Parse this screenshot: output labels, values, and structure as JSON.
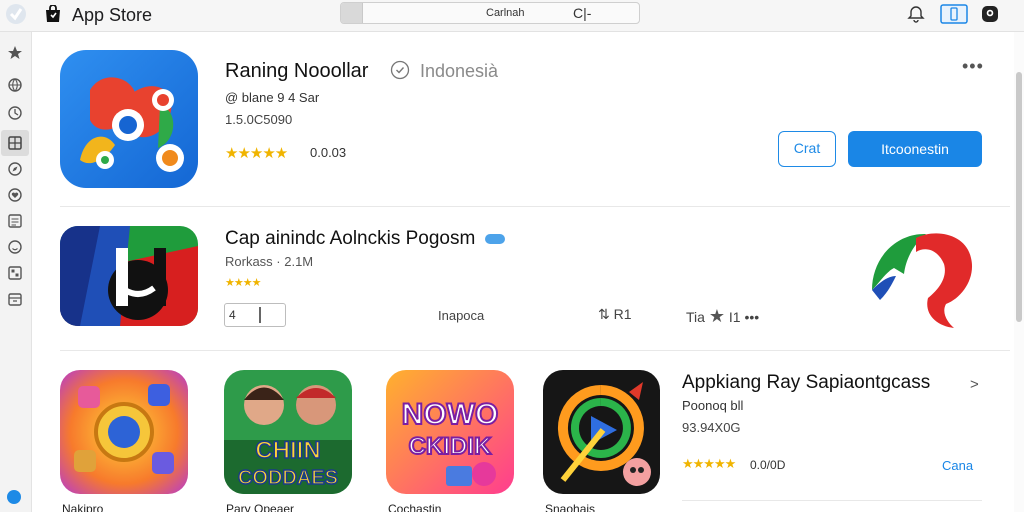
{
  "window": {
    "title": "App Store"
  },
  "toolbar": {
    "search_label": "Carlnah",
    "search_right": "C|-"
  },
  "featured": {
    "name": "Raning Nooollar",
    "region": "Indonesià",
    "meta": "@ blane 9 4 Sar",
    "number": "1.5.0C5090",
    "stars": "★★★★★",
    "rating": "0.0.03",
    "more": "•••",
    "secondary_button": "Crat",
    "primary_button": "Itcoonestin"
  },
  "row2": {
    "title": "Cap ainindc Aolnckis Pogosm",
    "meta": "Rorkass · 2.1M",
    "stars": "★★★★",
    "field_text": "4",
    "tag": "Inapoca",
    "stat1": "⇅ R1",
    "stat2_text": "Tia",
    "stat2_suffix": "I1",
    "stat2_dots": "•••"
  },
  "row3": {
    "tiles": [
      {
        "label": "Nakipro"
      },
      {
        "label": "Pary Opeaer"
      },
      {
        "label": "Cochastin"
      },
      {
        "label": "Snaohais"
      }
    ],
    "tile_texts": {
      "tile2": "CHIIN CODDAES",
      "tile3_line1": "NOWO",
      "tile3_line2": "CKIDIK"
    },
    "title": "Appkiang Ray Sapiaontgcass",
    "chevron": ">",
    "meta1": "Poonoq bll",
    "meta2": "93.94X0G",
    "stars": "★★★★★",
    "rating": "0.0/0D",
    "link": "Cana"
  },
  "colors": {
    "accent": "#1a86e6",
    "star": "#f0b400"
  },
  "icons": {
    "sidebar": [
      "star-icon",
      "globe-icon",
      "clock-icon",
      "grid-icon",
      "compass-icon",
      "heart-icon",
      "list-icon",
      "smile-icon",
      "apps-icon",
      "box-icon"
    ],
    "toolbar": [
      "bell-icon",
      "sidebar-toggle-icon",
      "profile-icon"
    ]
  }
}
